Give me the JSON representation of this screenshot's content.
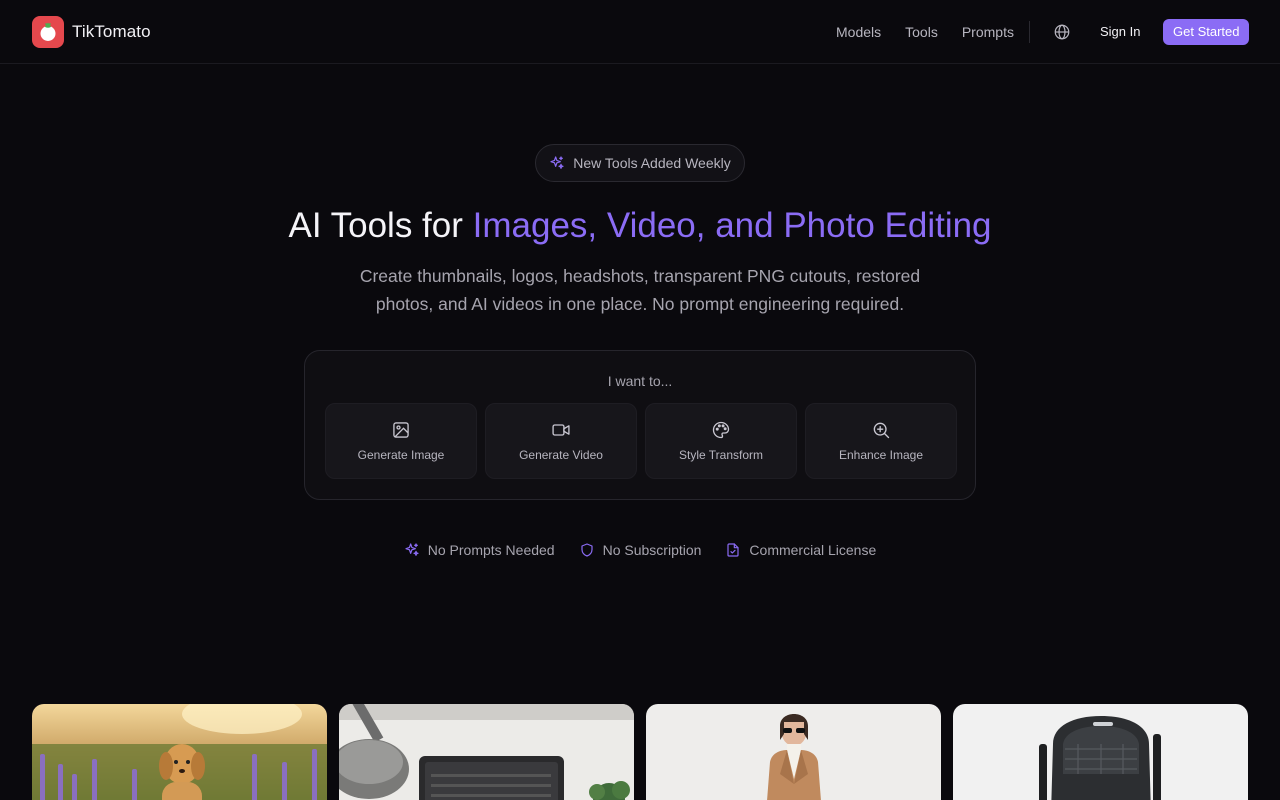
{
  "brand": {
    "name": "TikTomato"
  },
  "nav": {
    "models": "Models",
    "tools": "Tools",
    "prompts": "Prompts"
  },
  "auth": {
    "sign_in": "Sign In",
    "get_started": "Get Started"
  },
  "hero": {
    "badge": "New Tools Added Weekly",
    "title_prefix": "AI Tools for ",
    "title_accent": "Images, Video, and Photo Editing",
    "subtitle": "Create thumbnails, logos, headshots, transparent PNG cutouts, restored photos, and AI videos in one place. No prompt engineering required."
  },
  "chooser": {
    "label": "I want to...",
    "options": [
      {
        "label": "Generate Image",
        "icon": "image-icon"
      },
      {
        "label": "Generate Video",
        "icon": "video-icon"
      },
      {
        "label": "Style Transform",
        "icon": "palette-icon"
      },
      {
        "label": "Enhance Image",
        "icon": "zoom-in-icon"
      }
    ]
  },
  "features": [
    {
      "label": "No Prompts Needed",
      "icon": "sparkles-icon"
    },
    {
      "label": "No Subscription",
      "icon": "shield-icon"
    },
    {
      "label": "Commercial License",
      "icon": "file-check-icon"
    }
  ],
  "colors": {
    "accent": "#8b6cf5",
    "background": "#0a090d",
    "logo": "#e5484d"
  }
}
